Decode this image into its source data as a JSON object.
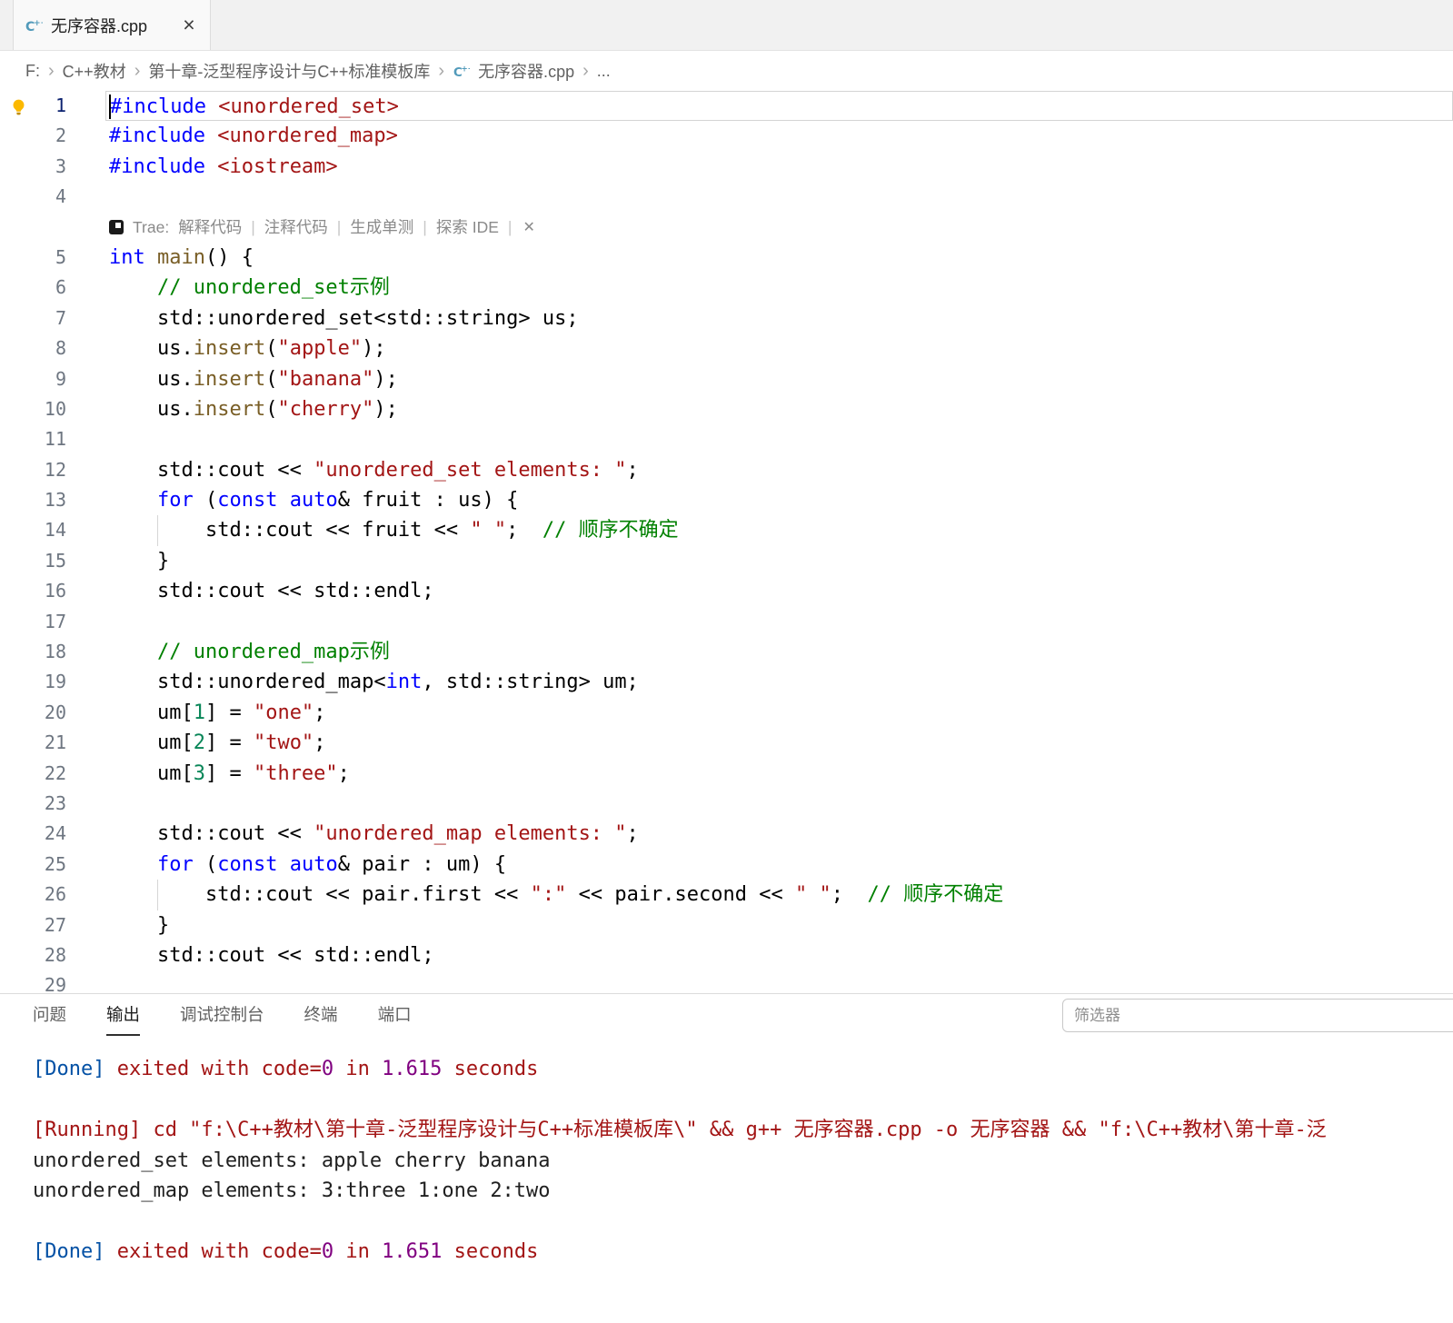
{
  "colors": {
    "kw": "#0000ff",
    "str": "#a31515",
    "com": "#008000",
    "fn": "#795e26",
    "num": "#098658",
    "def": "#000000",
    "obl": "#0451a5",
    "ored": "#a31515",
    "opur": "#800080",
    "odef": "#1f1f1f"
  },
  "tab": {
    "title": "无序容器.cpp",
    "close_glyph": "×"
  },
  "breadcrumb": {
    "separator": "›",
    "items": [
      "F:",
      "C++教材",
      "第十章-泛型程序设计与C++标准模板库",
      "无序容器.cpp",
      "..."
    ]
  },
  "hint": {
    "prefix": "Trae:",
    "actions": [
      "解释代码",
      "注释代码",
      "生成单测",
      "探索 IDE"
    ],
    "separator": "|",
    "close": "✕"
  },
  "editor": {
    "rows": [
      {
        "n": 1,
        "a": true,
        "b": true,
        "t": [
          [
            "#include",
            "kw"
          ],
          [
            " ",
            "def"
          ],
          [
            "<unordered_set>",
            "str"
          ]
        ]
      },
      {
        "n": 2,
        "t": [
          [
            "#include",
            "kw"
          ],
          [
            " ",
            "def"
          ],
          [
            "<unordered_map>",
            "str"
          ]
        ]
      },
      {
        "n": 3,
        "t": [
          [
            "#include",
            "kw"
          ],
          [
            " ",
            "def"
          ],
          [
            "<iostream>",
            "str"
          ]
        ]
      },
      {
        "n": 4,
        "t": []
      },
      {
        "h": true
      },
      {
        "n": 5,
        "t": [
          [
            "int",
            "kw"
          ],
          [
            " ",
            "def"
          ],
          [
            "main",
            "fn"
          ],
          [
            "() {",
            "def"
          ]
        ]
      },
      {
        "n": 6,
        "t": [
          [
            "    ",
            "def"
          ],
          [
            "// unordered_set示例",
            "com"
          ]
        ]
      },
      {
        "n": 7,
        "t": [
          [
            "    std::unordered_set<std::string> us;",
            "def"
          ]
        ]
      },
      {
        "n": 8,
        "t": [
          [
            "    us.",
            "def"
          ],
          [
            "insert",
            "fn"
          ],
          [
            "(",
            "def"
          ],
          [
            "\"apple\"",
            "str"
          ],
          [
            ");",
            "def"
          ]
        ]
      },
      {
        "n": 9,
        "t": [
          [
            "    us.",
            "def"
          ],
          [
            "insert",
            "fn"
          ],
          [
            "(",
            "def"
          ],
          [
            "\"banana\"",
            "str"
          ],
          [
            ");",
            "def"
          ]
        ]
      },
      {
        "n": 10,
        "t": [
          [
            "    us.",
            "def"
          ],
          [
            "insert",
            "fn"
          ],
          [
            "(",
            "def"
          ],
          [
            "\"cherry\"",
            "str"
          ],
          [
            ");",
            "def"
          ]
        ]
      },
      {
        "n": 11,
        "t": []
      },
      {
        "n": 12,
        "t": [
          [
            "    std::cout << ",
            "def"
          ],
          [
            "\"unordered_set elements: \"",
            "str"
          ],
          [
            ";",
            "def"
          ]
        ]
      },
      {
        "n": 13,
        "t": [
          [
            "    ",
            "def"
          ],
          [
            "for",
            "kw"
          ],
          [
            " (",
            "def"
          ],
          [
            "const",
            "kw"
          ],
          [
            " ",
            "def"
          ],
          [
            "auto",
            "kw"
          ],
          [
            "& fruit : us) {",
            "def"
          ]
        ]
      },
      {
        "n": 14,
        "g": true,
        "t": [
          [
            "        std::cout << fruit << ",
            "def"
          ],
          [
            "\" \"",
            "str"
          ],
          [
            ";  ",
            "def"
          ],
          [
            "// 顺序不确定",
            "com"
          ]
        ]
      },
      {
        "n": 15,
        "t": [
          [
            "    }",
            "def"
          ]
        ]
      },
      {
        "n": 16,
        "t": [
          [
            "    std::cout << std::endl;",
            "def"
          ]
        ]
      },
      {
        "n": 17,
        "t": []
      },
      {
        "n": 18,
        "t": [
          [
            "    ",
            "def"
          ],
          [
            "// unordered_map示例",
            "com"
          ]
        ]
      },
      {
        "n": 19,
        "t": [
          [
            "    std::unordered_map<",
            "def"
          ],
          [
            "int",
            "kw"
          ],
          [
            ", std::string> um;",
            "def"
          ]
        ]
      },
      {
        "n": 20,
        "t": [
          [
            "    um[",
            "def"
          ],
          [
            "1",
            "num"
          ],
          [
            "] = ",
            "def"
          ],
          [
            "\"one\"",
            "str"
          ],
          [
            ";",
            "def"
          ]
        ]
      },
      {
        "n": 21,
        "t": [
          [
            "    um[",
            "def"
          ],
          [
            "2",
            "num"
          ],
          [
            "] = ",
            "def"
          ],
          [
            "\"two\"",
            "str"
          ],
          [
            ";",
            "def"
          ]
        ]
      },
      {
        "n": 22,
        "t": [
          [
            "    um[",
            "def"
          ],
          [
            "3",
            "num"
          ],
          [
            "] = ",
            "def"
          ],
          [
            "\"three\"",
            "str"
          ],
          [
            ";",
            "def"
          ]
        ]
      },
      {
        "n": 23,
        "t": []
      },
      {
        "n": 24,
        "t": [
          [
            "    std::cout << ",
            "def"
          ],
          [
            "\"unordered_map elements: \"",
            "str"
          ],
          [
            ";",
            "def"
          ]
        ]
      },
      {
        "n": 25,
        "t": [
          [
            "    ",
            "def"
          ],
          [
            "for",
            "kw"
          ],
          [
            " (",
            "def"
          ],
          [
            "const",
            "kw"
          ],
          [
            " ",
            "def"
          ],
          [
            "auto",
            "kw"
          ],
          [
            "& pair : um) {",
            "def"
          ]
        ]
      },
      {
        "n": 26,
        "g": true,
        "t": [
          [
            "        std::cout << pair.first << ",
            "def"
          ],
          [
            "\":\"",
            "str"
          ],
          [
            " << pair.second << ",
            "def"
          ],
          [
            "\" \"",
            "str"
          ],
          [
            ";  ",
            "def"
          ],
          [
            "// 顺序不确定",
            "com"
          ]
        ]
      },
      {
        "n": 27,
        "t": [
          [
            "    }",
            "def"
          ]
        ]
      },
      {
        "n": 28,
        "t": [
          [
            "    std::cout << std::endl;",
            "def"
          ]
        ]
      },
      {
        "n": 29,
        "t": []
      }
    ]
  },
  "panel": {
    "tabs": [
      {
        "label": "问题",
        "active": false
      },
      {
        "label": "输出",
        "active": true
      },
      {
        "label": "调试控制台",
        "active": false
      },
      {
        "label": "终端",
        "active": false
      },
      {
        "label": "端口",
        "active": false
      }
    ],
    "filter_placeholder": "筛选器",
    "output": [
      {
        "t": [
          [
            "[Done]",
            "obl"
          ],
          [
            " exited with code=",
            "ored"
          ],
          [
            "0",
            "opur"
          ],
          [
            " in ",
            "ored"
          ],
          [
            "1.615",
            "opur"
          ],
          [
            " seconds",
            "ored"
          ]
        ]
      },
      {
        "t": []
      },
      {
        "t": [
          [
            "[Running] cd \"f:\\C++教材\\第十章-泛型程序设计与C++标准模板库\\\" && g++ 无序容器.cpp -o 无序容器 && \"f:\\C++教材\\第十章-泛",
            "ored"
          ]
        ]
      },
      {
        "t": [
          [
            "unordered_set elements: apple cherry banana",
            "odef"
          ]
        ]
      },
      {
        "t": [
          [
            "unordered_map elements: 3:three 1:one 2:two",
            "odef"
          ]
        ]
      },
      {
        "t": []
      },
      {
        "t": [
          [
            "[Done]",
            "obl"
          ],
          [
            " exited with code=",
            "ored"
          ],
          [
            "0",
            "opur"
          ],
          [
            " in ",
            "ored"
          ],
          [
            "1.651",
            "opur"
          ],
          [
            " seconds",
            "ored"
          ]
        ]
      }
    ]
  }
}
